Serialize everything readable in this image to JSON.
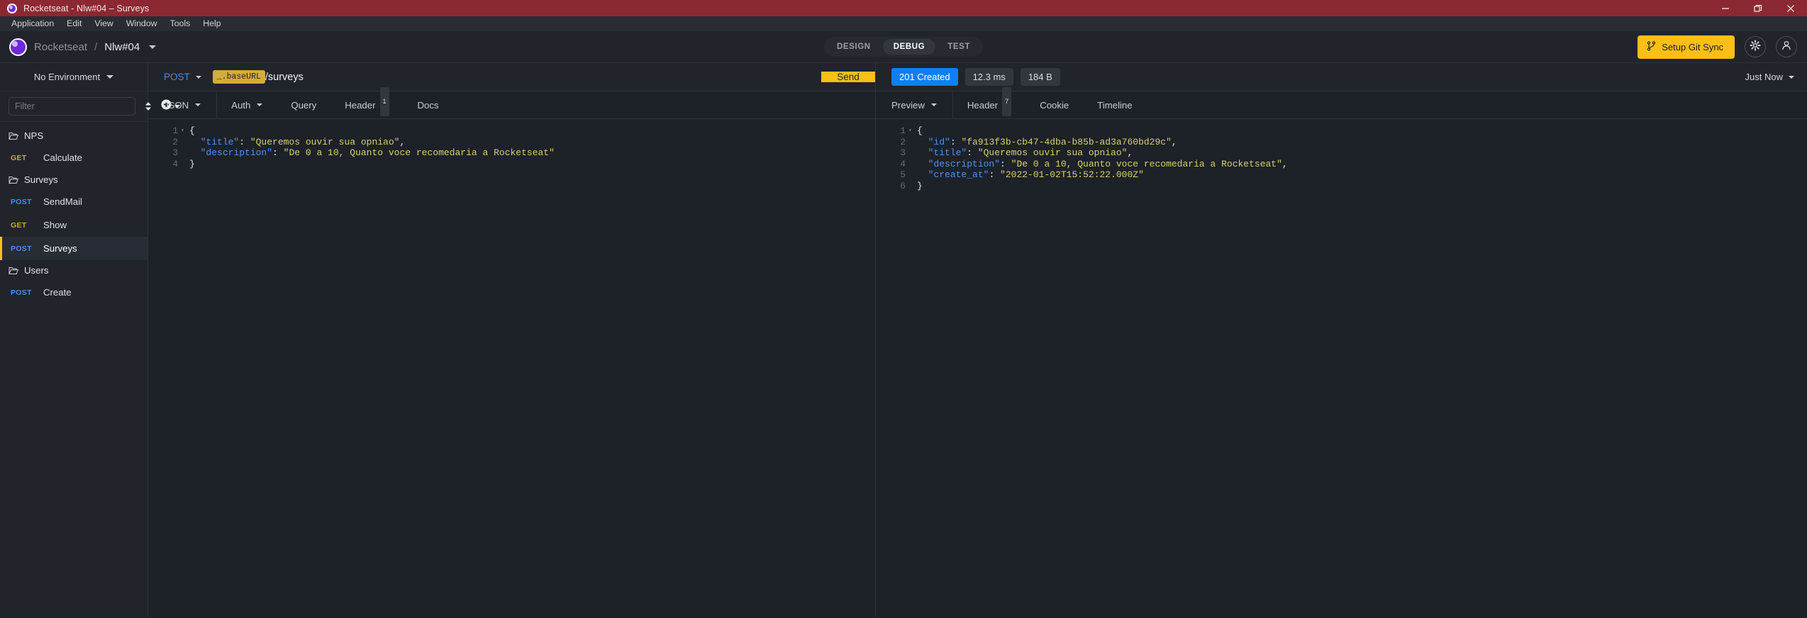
{
  "window": {
    "title": "Rocketseat - Nlw#04 – Surveys",
    "logo_icon": "rocketseat-logo-icon",
    "controls": [
      {
        "name": "minimize-button",
        "icon": "minimize-icon"
      },
      {
        "name": "maximize-button",
        "icon": "restore-icon"
      },
      {
        "name": "close-button",
        "icon": "close-icon"
      }
    ]
  },
  "menubar": {
    "items": [
      {
        "label": "Application"
      },
      {
        "label": "Edit"
      },
      {
        "label": "View"
      },
      {
        "label": "Window"
      },
      {
        "label": "Tools"
      },
      {
        "label": "Help"
      }
    ]
  },
  "header": {
    "workspace": "Rocketseat",
    "separator": "/",
    "project": "Nlw#04",
    "modes": [
      {
        "label": "DESIGN",
        "active": false
      },
      {
        "label": "DEBUG",
        "active": true
      },
      {
        "label": "TEST",
        "active": false
      }
    ],
    "git_sync_label": "Setup Git Sync",
    "git_sync_icon": "git-branch-icon",
    "settings_icon": "gear-icon",
    "account_icon": "account-icon",
    "accent_yellow": "#fbbf16"
  },
  "sidebar": {
    "environment": "No Environment",
    "filter_placeholder": "Filter",
    "filter_value": "",
    "sort_icon": "sort-icon",
    "add_icon": "plus-circle-icon",
    "tree": [
      {
        "type": "folder",
        "label": "NPS",
        "icon": "folder-open-icon"
      },
      {
        "type": "request",
        "method": "GET",
        "label": "Calculate",
        "active": false
      },
      {
        "type": "folder",
        "label": "Surveys",
        "icon": "folder-open-icon"
      },
      {
        "type": "request",
        "method": "POST",
        "label": "SendMail",
        "active": false
      },
      {
        "type": "request",
        "method": "GET",
        "label": "Show",
        "active": false
      },
      {
        "type": "request",
        "method": "POST",
        "label": "Surveys",
        "active": true
      },
      {
        "type": "folder",
        "label": "Users",
        "icon": "folder-open-icon"
      },
      {
        "type": "request",
        "method": "POST",
        "label": "Create",
        "active": false
      }
    ]
  },
  "request": {
    "method": "POST",
    "url_template_tag": "_.baseURL",
    "url_path": "/surveys",
    "send_label": "Send",
    "tabs": [
      {
        "label": "JSON",
        "has_caret": true,
        "badge": ""
      },
      {
        "label": "Auth",
        "has_caret": true,
        "badge": ""
      },
      {
        "label": "Query",
        "has_caret": false,
        "badge": ""
      },
      {
        "label": "Header",
        "has_caret": false,
        "badge": "1"
      },
      {
        "label": "Docs",
        "has_caret": false,
        "badge": ""
      }
    ],
    "body_lines": [
      {
        "n": "1",
        "fold": "▾",
        "tokens": [
          {
            "c": "punc",
            "t": "{"
          }
        ]
      },
      {
        "n": "2",
        "fold": "",
        "tokens": [
          {
            "c": "punc",
            "t": "  "
          },
          {
            "c": "key",
            "t": "\"title\""
          },
          {
            "c": "punc",
            "t": ": "
          },
          {
            "c": "str",
            "t": "\"Queremos ouvir sua opniao\""
          },
          {
            "c": "punc",
            "t": ","
          }
        ]
      },
      {
        "n": "3",
        "fold": "",
        "tokens": [
          {
            "c": "punc",
            "t": "  "
          },
          {
            "c": "key",
            "t": "\"description\""
          },
          {
            "c": "punc",
            "t": ": "
          },
          {
            "c": "str",
            "t": "\"De 0 a 10, Quanto voce recomedaria a Rocketseat\""
          }
        ]
      },
      {
        "n": "4",
        "fold": "",
        "tokens": [
          {
            "c": "punc",
            "t": "}"
          }
        ]
      }
    ]
  },
  "response": {
    "status": "201 Created",
    "time": "12.3 ms",
    "size": "184 B",
    "history": "Just Now",
    "status_color": "#0f7ff5",
    "tabs": [
      {
        "label": "Preview",
        "has_caret": true,
        "badge": ""
      },
      {
        "label": "Header",
        "has_caret": false,
        "badge": "7"
      },
      {
        "label": "Cookie",
        "has_caret": false,
        "badge": ""
      },
      {
        "label": "Timeline",
        "has_caret": false,
        "badge": ""
      }
    ],
    "body_lines": [
      {
        "n": "1",
        "fold": "▾",
        "tokens": [
          {
            "c": "punc",
            "t": "{"
          }
        ]
      },
      {
        "n": "2",
        "fold": "",
        "tokens": [
          {
            "c": "punc",
            "t": "  "
          },
          {
            "c": "key",
            "t": "\"id\""
          },
          {
            "c": "punc",
            "t": ": "
          },
          {
            "c": "str",
            "t": "\"fa913f3b-cb47-4dba-b85b-ad3a760bd29c\""
          },
          {
            "c": "punc",
            "t": ","
          }
        ]
      },
      {
        "n": "3",
        "fold": "",
        "tokens": [
          {
            "c": "punc",
            "t": "  "
          },
          {
            "c": "key",
            "t": "\"title\""
          },
          {
            "c": "punc",
            "t": ": "
          },
          {
            "c": "str",
            "t": "\"Queremos ouvir sua opniao\""
          },
          {
            "c": "punc",
            "t": ","
          }
        ]
      },
      {
        "n": "4",
        "fold": "",
        "tokens": [
          {
            "c": "punc",
            "t": "  "
          },
          {
            "c": "key",
            "t": "\"description\""
          },
          {
            "c": "punc",
            "t": ": "
          },
          {
            "c": "str",
            "t": "\"De 0 a 10, Quanto voce recomedaria a Rocketseat\""
          },
          {
            "c": "punc",
            "t": ","
          }
        ]
      },
      {
        "n": "5",
        "fold": "",
        "tokens": [
          {
            "c": "punc",
            "t": "  "
          },
          {
            "c": "key",
            "t": "\"create_at\""
          },
          {
            "c": "punc",
            "t": ": "
          },
          {
            "c": "str",
            "t": "\"2022-01-02T15:52:22.000Z\""
          }
        ]
      },
      {
        "n": "6",
        "fold": "",
        "tokens": [
          {
            "c": "punc",
            "t": "}"
          }
        ]
      }
    ]
  }
}
